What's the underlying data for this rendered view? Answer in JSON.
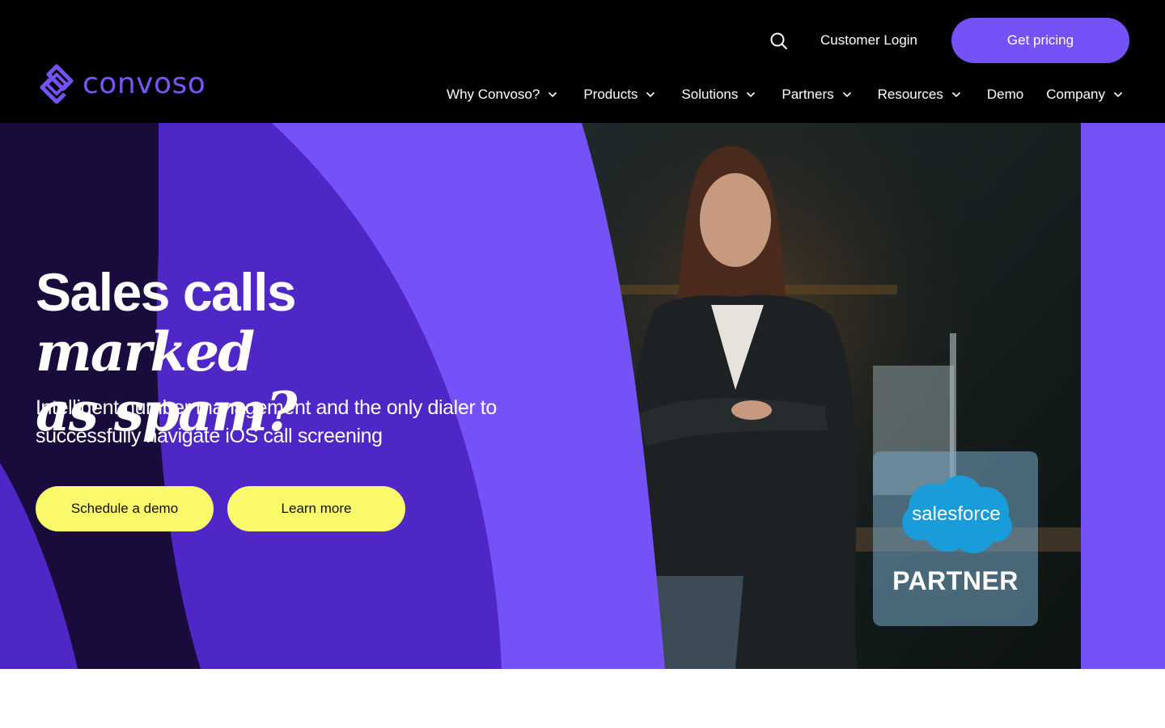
{
  "brand": {
    "name": "convoso",
    "accent": "#7552f7",
    "dark_purple": "#4f27c6",
    "deep_purple": "#190b3b",
    "cta_yellow": "#fbfa6b"
  },
  "header": {
    "search_icon": "search-icon",
    "customer_login": "Customer Login",
    "get_pricing": "Get pricing",
    "nav": [
      {
        "label": "Why Convoso?",
        "has_dropdown": true
      },
      {
        "label": "Products",
        "has_dropdown": true
      },
      {
        "label": "Solutions",
        "has_dropdown": true
      },
      {
        "label": "Partners",
        "has_dropdown": true
      },
      {
        "label": "Resources",
        "has_dropdown": true
      },
      {
        "label": "Demo",
        "has_dropdown": false
      },
      {
        "label": "Company",
        "has_dropdown": true
      }
    ]
  },
  "hero": {
    "headline_plain": "Sales calls ",
    "headline_italic_1": "marked",
    "headline_italic_2": "as spam?",
    "subtext": "Intelligent number management and the only dialer to successfully navigate iOS call screening",
    "cta_primary": "Schedule a demo",
    "cta_secondary": "Learn more",
    "badge": {
      "logo_word": "salesforce",
      "label": "PARTNER"
    }
  }
}
